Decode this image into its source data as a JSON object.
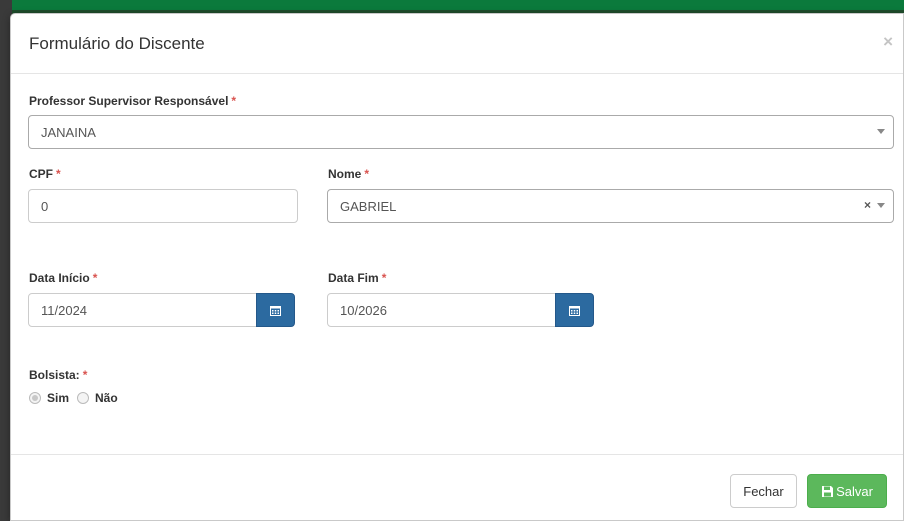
{
  "modal": {
    "title": "Formulário do Discente",
    "close_glyph": "×"
  },
  "form": {
    "supervisor": {
      "label": "Professor Supervisor Responsável",
      "required_mark": "*",
      "value": "JANAINA"
    },
    "cpf": {
      "label": "CPF",
      "required_mark": "*",
      "value": "0"
    },
    "nome": {
      "label": "Nome",
      "required_mark": "*",
      "value": "GABRIEL",
      "clear_glyph": "×"
    },
    "data_inicio": {
      "label": "Data Início",
      "required_mark": "*",
      "value": "11/2024",
      "icon": "calendar-icon"
    },
    "data_fim": {
      "label": "Data Fim",
      "required_mark": "*",
      "value": "10/2026",
      "icon": "calendar-icon"
    },
    "bolsista": {
      "label": "Bolsista:",
      "required_mark": "*",
      "options": [
        "Sim",
        "Não"
      ],
      "selected": "Sim"
    }
  },
  "footer": {
    "fechar_label": "Fechar",
    "salvar_label": "Salvar",
    "salvar_icon": "floppy-disk-icon"
  },
  "colors": {
    "primary_button": "#2c6aa0",
    "success_button": "#5cb85c",
    "required": "#d9534f"
  }
}
